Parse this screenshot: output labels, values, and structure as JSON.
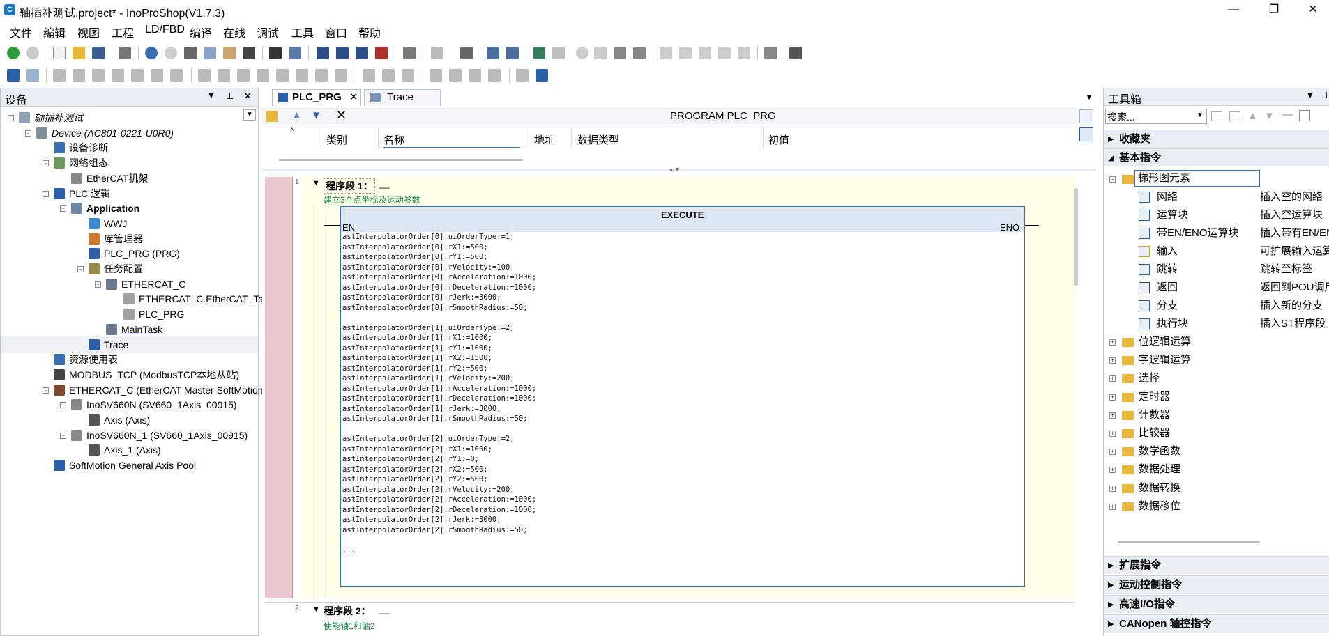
{
  "window": {
    "title": "轴插补测试.project* - InoProShop(V1.7.3)",
    "min": "—",
    "max": "❐",
    "close": "✕"
  },
  "menu": [
    "文件",
    "编辑",
    "视图",
    "工程",
    "LD/FBD",
    "编译",
    "在线",
    "调试",
    "工具",
    "窗口",
    "帮助"
  ],
  "device_panel": {
    "title": "设备",
    "tree": [
      {
        "label": "轴插补测试",
        "indent": 0,
        "italic": true,
        "icon": "project-icon",
        "exp": "-"
      },
      {
        "label": "Device (AC801-0221-U0R0)",
        "indent": 1,
        "italic": true,
        "icon": "device-icon",
        "exp": "-"
      },
      {
        "label": "设备诊断",
        "indent": 2,
        "icon": "diagnose-icon",
        "exp": ""
      },
      {
        "label": "网络组态",
        "indent": 2,
        "icon": "network-config-icon",
        "exp": "-"
      },
      {
        "label": "EtherCAT机架",
        "indent": 3,
        "icon": "ethercat-rack-icon",
        "exp": ""
      },
      {
        "label": "PLC 逻辑",
        "indent": 2,
        "icon": "plc-logic-icon",
        "exp": "-"
      },
      {
        "label": "Application",
        "indent": 3,
        "bold": true,
        "icon": "application-gear-icon",
        "exp": "-"
      },
      {
        "label": "WWJ",
        "indent": 4,
        "icon": "globe-icon",
        "exp": ""
      },
      {
        "label": "库管理器",
        "indent": 4,
        "icon": "library-icon",
        "exp": ""
      },
      {
        "label": "PLC_PRG (PRG)",
        "indent": 4,
        "icon": "program-icon",
        "exp": ""
      },
      {
        "label": "任务配置",
        "indent": 4,
        "icon": "task-config-icon",
        "exp": "-"
      },
      {
        "label": "ETHERCAT_C",
        "indent": 5,
        "icon": "task-icon",
        "exp": "-"
      },
      {
        "label": "ETHERCAT_C.EtherCAT_Ta",
        "indent": 6,
        "icon": "program-call-icon",
        "exp": ""
      },
      {
        "label": "PLC_PRG",
        "indent": 6,
        "icon": "program-call-icon",
        "exp": ""
      },
      {
        "label": "MainTask",
        "indent": 5,
        "underline": true,
        "icon": "task-icon",
        "exp": ""
      },
      {
        "label": "Trace",
        "indent": 4,
        "icon": "trace-icon",
        "exp": "",
        "selected": true
      },
      {
        "label": "资源使用表",
        "indent": 2,
        "icon": "resource-table-icon",
        "exp": ""
      },
      {
        "label": "MODBUS_TCP (ModbusTCP本地从站)",
        "indent": 2,
        "icon": "modbus-icon",
        "exp": ""
      },
      {
        "label": "ETHERCAT_C (EtherCAT Master SoftMotion)",
        "indent": 2,
        "icon": "ethercat-master-icon",
        "exp": "-"
      },
      {
        "label": "InoSV660N (SV660_1Axis_00915)",
        "indent": 3,
        "icon": "servo-drive-icon",
        "exp": "-"
      },
      {
        "label": "Axis (Axis)",
        "indent": 4,
        "icon": "axis-icon",
        "exp": ""
      },
      {
        "label": "InoSV660N_1 (SV660_1Axis_00915)",
        "indent": 3,
        "icon": "servo-drive-icon",
        "exp": "-"
      },
      {
        "label": "Axis_1 (Axis)",
        "indent": 4,
        "icon": "axis-icon",
        "exp": ""
      },
      {
        "label": "SoftMotion General Axis Pool",
        "indent": 2,
        "icon": "axis-pool-icon",
        "exp": ""
      }
    ]
  },
  "editor": {
    "tabs": [
      {
        "label": "PLC_PRG",
        "active": true
      },
      {
        "label": "Trace"
      }
    ],
    "program_title": "PROGRAM PLC_PRG",
    "columns": [
      "类别",
      "名称",
      "地址",
      "数据类型",
      "初值"
    ],
    "network1": {
      "num": "1",
      "title": "程序段 1：",
      "comment": "建立3个点坐标及运动参数",
      "block_title": "EXECUTE",
      "en": "EN",
      "eno": "ENO",
      "code": "astInterpolatorOrder[0].uiOrderType:=1;\nastInterpolatorOrder[0].rX1:=500;\nastInterpolatorOrder[0].rY1:=500;\nastInterpolatorOrder[0].rVelocity:=100;\nastInterpolatorOrder[0].rAcceleration:=1000;\nastInterpolatorOrder[0].rDeceleration:=1000;\nastInterpolatorOrder[0].rJerk:=3000;\nastInterpolatorOrder[0].rSmoothRadius:=50;\n\nastInterpolatorOrder[1].uiOrderType:=2;\nastInterpolatorOrder[1].rX1:=1000;\nastInterpolatorOrder[1].rY1:=1000;\nastInterpolatorOrder[1].rX2:=1500;\nastInterpolatorOrder[1].rY2:=500;\nastInterpolatorOrder[1].rVelocity:=200;\nastInterpolatorOrder[1].rAcceleration:=1000;\nastInterpolatorOrder[1].rDeceleration:=1000;\nastInterpolatorOrder[1].rJerk:=3000;\nastInterpolatorOrder[1].rSmoothRadius:=50;\n\nastInterpolatorOrder[2].uiOrderType:=2;\nastInterpolatorOrder[2].rX1:=1000;\nastInterpolatorOrder[2].rY1:=0;\nastInterpolatorOrder[2].rX2:=500;\nastInterpolatorOrder[2].rY2:=500;\nastInterpolatorOrder[2].rVelocity:=200;\nastInterpolatorOrder[2].rAcceleration:=1000;\nastInterpolatorOrder[2].rDeceleration:=1000;\nastInterpolatorOrder[2].rJerk:=3000;\nastInterpolatorOrder[2].rSmoothRadius:=50;\n\n..."
    },
    "network2": {
      "num": "2",
      "title": "程序段 2：",
      "comment": "使能轴1和轴2"
    }
  },
  "toolbox": {
    "title": "工具箱",
    "search_placeholder": "搜索...",
    "sections_top": [
      "收藏夹",
      "基本指令"
    ],
    "ladder_group": "梯形图元素",
    "ladder_items": [
      {
        "name": "网络",
        "desc": "插入空的网络",
        "icon": "network-icon"
      },
      {
        "name": "运算块",
        "desc": "插入空运算块",
        "icon": "box-icon"
      },
      {
        "name": "带EN/ENO运算块",
        "desc": "插入带有EN/EN",
        "icon": "box-en-icon"
      },
      {
        "name": "输入",
        "desc": "可扩展输入运算",
        "icon": "input-icon"
      },
      {
        "name": "跳转",
        "desc": "跳转至标签",
        "icon": "jump-icon"
      },
      {
        "name": "返回",
        "desc": "返回到POU调用",
        "icon": "return-icon"
      },
      {
        "name": "分支",
        "desc": "插入新的分支",
        "icon": "branch-icon"
      },
      {
        "name": "执行块",
        "desc": "插入ST程序段",
        "icon": "execute-block-icon"
      }
    ],
    "folders": [
      "位逻辑运算",
      "字逻辑运算",
      "选择",
      "定时器",
      "计数器",
      "比较器",
      "数学函数",
      "数据处理",
      "数据转换",
      "数据移位"
    ],
    "sections_bottom": [
      "扩展指令",
      "运动控制指令",
      "高速I/O指令",
      "CANopen 轴控指令"
    ]
  }
}
